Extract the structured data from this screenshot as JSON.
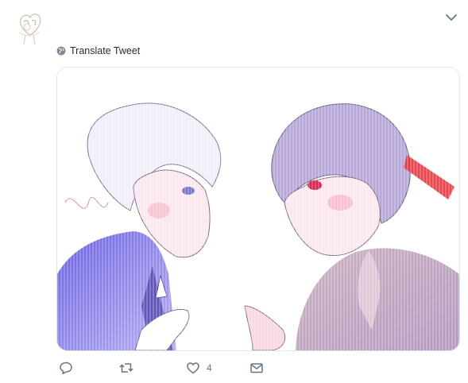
{
  "tweet": {
    "translate_label": "Translate Tweet",
    "media_alt": "Illustration of two anime-style characters facing each other",
    "actions": {
      "reply_count": "",
      "retweet_count": "",
      "like_count": "4"
    }
  },
  "colors": {
    "icon_gray": "#657786",
    "border": "#e1e8ed"
  },
  "icons": [
    "avatar-sketch",
    "chevron-down-icon",
    "globe-icon",
    "reply-icon",
    "retweet-icon",
    "like-icon",
    "share-mail-icon"
  ]
}
